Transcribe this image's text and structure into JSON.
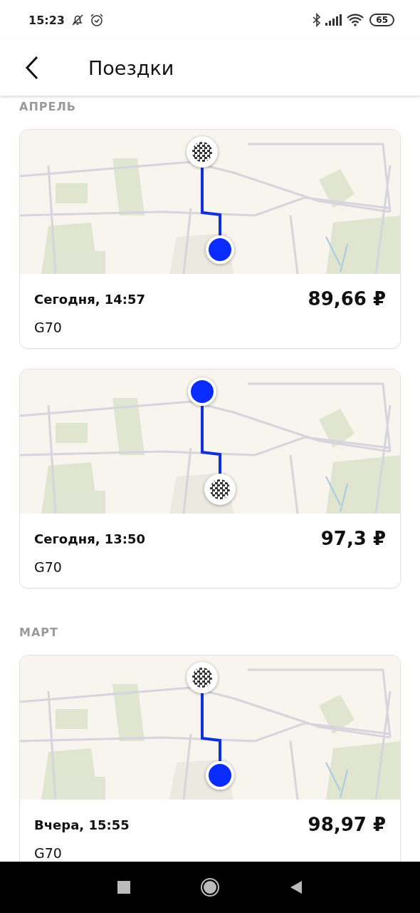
{
  "status_bar": {
    "time": "15:23",
    "battery": "65"
  },
  "header": {
    "title": "Поездки"
  },
  "sections": [
    {
      "title": "АПРЕЛЬ",
      "trips": [
        {
          "date": "Сегодня, 14:57",
          "price": "89,66 ₽",
          "car": "G70",
          "start_on_top": false
        },
        {
          "date": "Сегодня, 13:50",
          "price": "97,3 ₽",
          "car": "G70",
          "start_on_top": true
        }
      ]
    },
    {
      "title": "МАРТ",
      "trips": [
        {
          "date": "Вчера, 15:55",
          "price": "98,97 ₽",
          "car": "G70",
          "start_on_top": false
        }
      ]
    }
  ]
}
